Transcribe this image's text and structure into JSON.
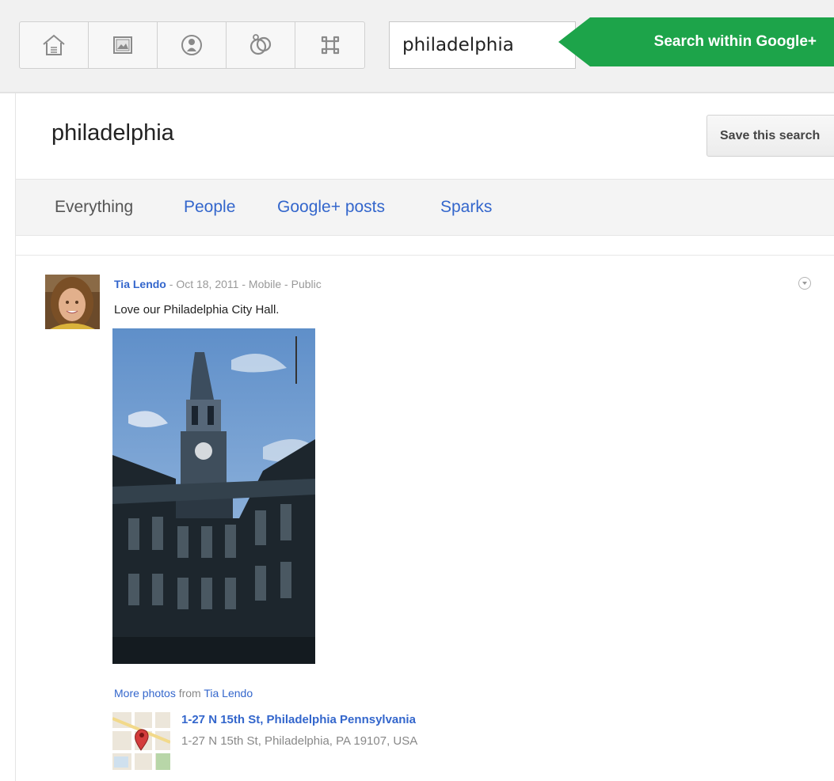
{
  "nav": {
    "items": [
      {
        "icon": "home-icon"
      },
      {
        "icon": "photos-icon"
      },
      {
        "icon": "profile-icon"
      },
      {
        "icon": "circles-icon"
      },
      {
        "icon": "games-icon"
      }
    ]
  },
  "search": {
    "value": "philadelphia",
    "button_label": "Search within Google+"
  },
  "query": {
    "title": "philadelphia",
    "save_label": "Save this search"
  },
  "tabs": [
    {
      "label": "Everything",
      "active": true
    },
    {
      "label": "People",
      "active": false
    },
    {
      "label": "Google+ posts",
      "active": false
    },
    {
      "label": "Sparks",
      "active": false
    }
  ],
  "post": {
    "author": "Tia Lendo",
    "sep": " - ",
    "date": "Oct 18, 2011",
    "source": "Mobile",
    "visibility": "Public",
    "text": "Love our Philadelphia City Hall.",
    "more_photos_label": "More photos",
    "from_label": " from ",
    "more_photos_author": "Tia Lendo",
    "location": {
      "title": "1-27 N 15th St, Philadelphia Pennsylvania",
      "address": "1-27 N 15th St, Philadelphia, PA 19107, USA"
    }
  },
  "colors": {
    "link": "#3366cc",
    "search_button": "#1da44a",
    "topbar": "#f1f1f1"
  }
}
